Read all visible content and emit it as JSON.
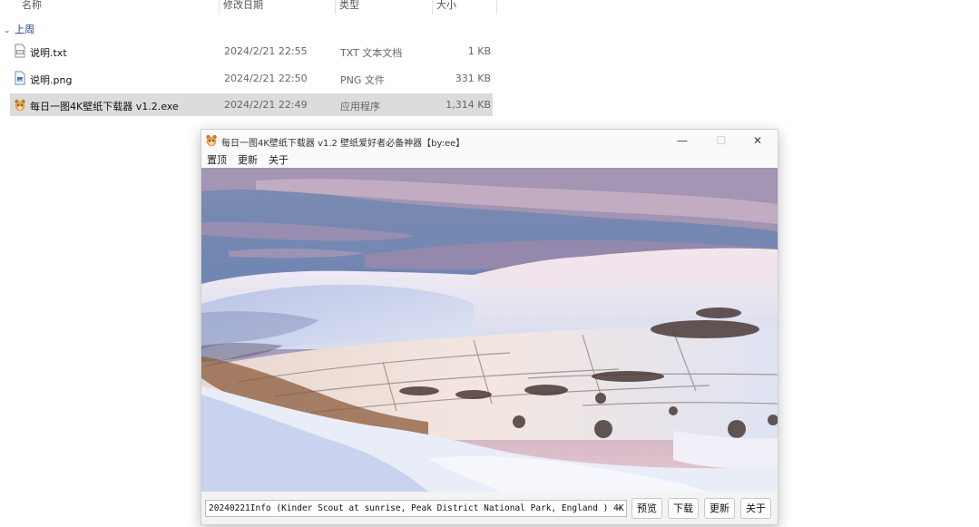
{
  "explorer": {
    "columns": {
      "name": "名称",
      "date": "修改日期",
      "type": "类型",
      "size": "大小"
    },
    "group_label": "上周",
    "files": [
      {
        "name": "说明.txt",
        "date": "2024/2/21 22:55",
        "type": "TXT 文本文档",
        "size": "1 KB",
        "icon": "txt-file-icon",
        "selected": false
      },
      {
        "name": "说明.png",
        "date": "2024/2/21 22:50",
        "type": "PNG 文件",
        "size": "331 KB",
        "icon": "png-file-icon",
        "selected": false
      },
      {
        "name": "每日一图4K壁纸下载器 v1.2.exe",
        "date": "2024/2/21 22:49",
        "type": "应用程序",
        "size": "1,314 KB",
        "icon": "app-exe-icon",
        "selected": true
      }
    ]
  },
  "app": {
    "title": "每日一图4K壁纸下载器 v1.2  壁纸爱好者必备神器【by:ee】",
    "window_controls": {
      "minimize": "—",
      "maximize": "☐",
      "close": "✕"
    },
    "menu": [
      "置顶",
      "更新",
      "关于"
    ],
    "info_text": "20240221Info (Kinder Scout at sunrise, Peak District National Park, England ) 4K",
    "buttons": [
      "预览",
      "下载",
      "更新",
      "关于"
    ]
  }
}
